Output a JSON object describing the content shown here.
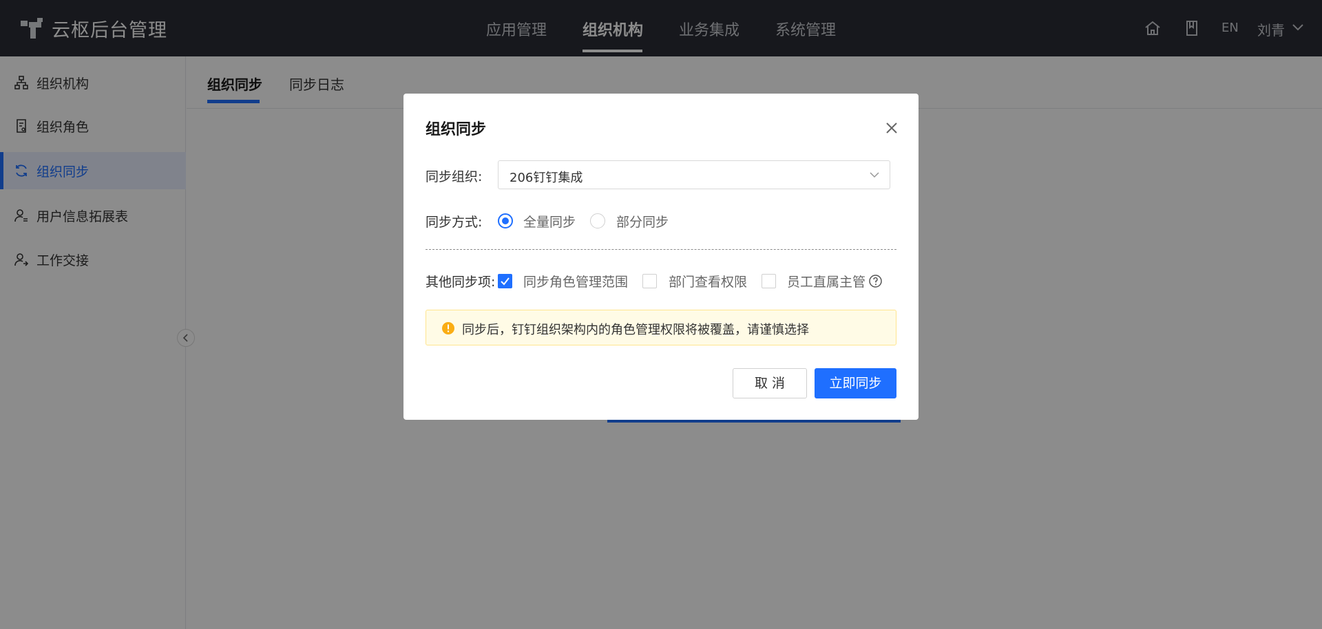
{
  "header": {
    "app_title": "云枢后台管理",
    "nav": [
      {
        "label": "应用管理",
        "active": false
      },
      {
        "label": "组织机构",
        "active": true
      },
      {
        "label": "业务集成",
        "active": false
      },
      {
        "label": "系统管理",
        "active": false
      }
    ],
    "icons": [
      "home-icon",
      "book-icon"
    ],
    "lang": "EN",
    "user": "刘青"
  },
  "sidebar": {
    "items": [
      {
        "label": "组织机构",
        "icon": "org-tree-icon",
        "active": false
      },
      {
        "label": "组织角色",
        "icon": "role-doc-icon",
        "active": false
      },
      {
        "label": "组织同步",
        "icon": "sync-icon",
        "active": true
      },
      {
        "label": "用户信息拓展表",
        "icon": "user-list-icon",
        "active": false
      },
      {
        "label": "工作交接",
        "icon": "user-handover-icon",
        "active": false
      }
    ]
  },
  "tabs": [
    {
      "label": "组织同步",
      "active": true
    },
    {
      "label": "同步日志",
      "active": false
    }
  ],
  "modal": {
    "title": "组织同步",
    "org_label": "同步组织:",
    "org_value": "206钉钉集成",
    "mode_label": "同步方式:",
    "mode_options": [
      {
        "label": "全量同步",
        "checked": true
      },
      {
        "label": "部分同步",
        "checked": false
      }
    ],
    "other_label": "其他同步项:",
    "other_options": [
      {
        "label": "同步角色管理范围",
        "checked": true
      },
      {
        "label": "部门查看权限",
        "checked": false
      },
      {
        "label": "员工直属主管",
        "checked": false
      }
    ],
    "alert_text": "同步后，钉钉组织架构内的角色管理权限将被覆盖，请谨慎选择",
    "cancel_label": "取 消",
    "confirm_label": "立即同步"
  },
  "colors": {
    "primary": "#1f6fff",
    "header_bg": "#2a2d35",
    "warning": "#faad14"
  }
}
